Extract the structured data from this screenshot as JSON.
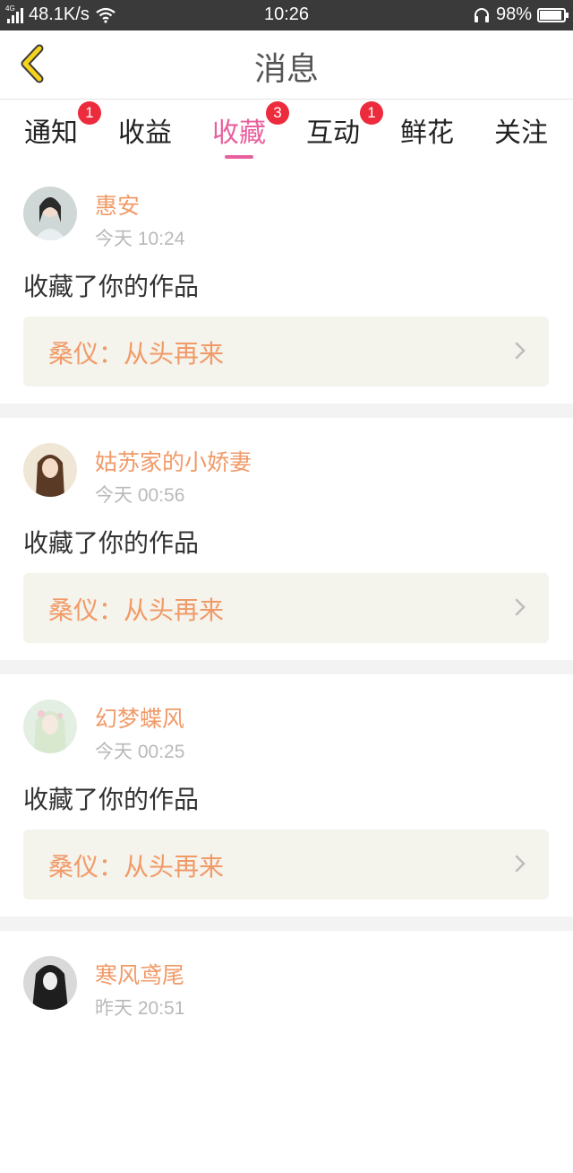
{
  "status_bar": {
    "network_type": "4G",
    "speed": "48.1K/s",
    "time": "10:26",
    "battery": "98%",
    "battery_fraction": 0.98
  },
  "header": {
    "title": "消息",
    "back_icon": "chevron-left-icon"
  },
  "tabs": [
    {
      "label": "通知",
      "badge": "1"
    },
    {
      "label": "收益",
      "badge": ""
    },
    {
      "label": "收藏",
      "badge": "3",
      "active": true
    },
    {
      "label": "互动",
      "badge": "1"
    },
    {
      "label": "鲜花",
      "badge": ""
    },
    {
      "label": "关注",
      "badge": ""
    }
  ],
  "messages": [
    {
      "user": "惠安",
      "time": "今天 10:24",
      "action": "收藏了你的作品",
      "work": "桑仪：从头再来"
    },
    {
      "user": "姑苏家的小娇妻",
      "time": "今天 00:56",
      "action": "收藏了你的作品",
      "work": "桑仪：从头再来"
    },
    {
      "user": "幻梦蝶风",
      "time": "今天 00:25",
      "action": "收藏了你的作品",
      "work": "桑仪：从头再来"
    },
    {
      "user": "寒风鸢尾",
      "time": "昨天 20:51",
      "action": "",
      "work": ""
    }
  ],
  "colors": {
    "accent_pink": "#e8619e",
    "username_orange": "#f19a68",
    "badge_red": "#ec2b3c",
    "back_yellow": "#f5d21c",
    "status_bar_bg": "#3a3a3a",
    "work_bg": "#f4f3ec"
  }
}
